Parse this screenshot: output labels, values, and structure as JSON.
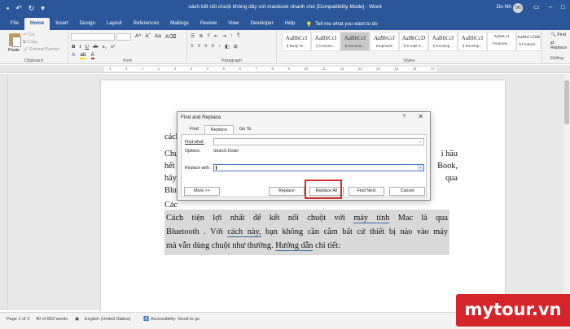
{
  "titlebar": {
    "title": "cách kết nối chuột không dây với macbook nhanh chó [Compatibility Mode] - Word",
    "user": "Do Nh",
    "avatar": "DN"
  },
  "tabs": [
    "File",
    "Home",
    "Insert",
    "Design",
    "Layout",
    "References",
    "Mailings",
    "Review",
    "View",
    "Developer",
    "Help"
  ],
  "tell_me": "Tell me what you want to do",
  "clipboard": {
    "paste": "Paste",
    "cut": "Cut",
    "copy": "Copy",
    "format_painter": "Format Painter",
    "label": "Clipboard"
  },
  "font": {
    "label": "Font"
  },
  "paragraph": {
    "label": "Paragraph"
  },
  "styles": {
    "label": "Styles",
    "items": [
      {
        "sample": "AaBbCcI",
        "name": "¶ Body Te..."
      },
      {
        "sample": "AaBbCcI",
        "name": "¶ Comme..."
      },
      {
        "sample": "AaBbCcI",
        "name": "¶ Docume..."
      },
      {
        "sample": "AaBbCcI",
        "name": "Emphasis"
      },
      {
        "sample": "AaBbCcD",
        "name": "¶ E-mail S..."
      },
      {
        "sample": "AaBbCcI",
        "name": "¶ Envelop..."
      },
      {
        "sample": "AaBbCcI",
        "name": "¶ Envelop..."
      },
      {
        "sample": "AaBbCcI",
        "name": "Footnote..."
      },
      {
        "sample": "AaBbCcDdE",
        "name": "¶ Footnot..."
      }
    ]
  },
  "editing": {
    "find": "Find",
    "replace": "Replace",
    "label": "Editing"
  },
  "ruler_numbers": [
    "3",
    "2",
    "1",
    "1",
    "2",
    "3",
    "4",
    "5",
    "6",
    "7",
    "8",
    "9",
    "10",
    "11",
    "12",
    "13",
    "14",
    "15",
    "16",
    "17"
  ],
  "document": {
    "left_fragments": [
      "cách",
      "Chu",
      "hết",
      "hãy",
      "Blu",
      "Các"
    ],
    "right_fragments": [
      "i hầu",
      "Book,",
      "qua"
    ],
    "highlight_lines": [
      [
        "Cách",
        "tiện",
        "lợi",
        "nhất",
        "để",
        "kết",
        "nối",
        "chuột",
        "với",
        "máy tính",
        "Mac",
        "là",
        "qua"
      ],
      [
        "Bluetooth .",
        "Với",
        "cách này,",
        "bạn",
        "không",
        "cần",
        "cắm",
        "bất cứ",
        "thiết",
        "bị",
        "nào",
        "vào",
        "máy"
      ],
      [
        "mà",
        "vẫn",
        "dùng",
        "chuột",
        "như",
        "thường.",
        "Hướng dẫn",
        "chi",
        "tiết:"
      ]
    ]
  },
  "dialog": {
    "title": "Find and Replace",
    "help": "?",
    "close": "✕",
    "tabs": [
      "Find",
      "Replace",
      "Go To"
    ],
    "find_label": "Find what:",
    "options_label": "Options:",
    "options_value": "Search Down",
    "replace_label": "Replace with:",
    "find_value": "",
    "replace_value": "",
    "buttons": {
      "more": "More >>",
      "replace": "Replace",
      "replace_all": "Replace All",
      "find_next": "Find Next",
      "cancel": "Cancel"
    }
  },
  "status": {
    "page": "Page 1 of 3",
    "words": "40 of 803 words",
    "language": "English (United States)",
    "accessibility": "Accessibility: Good to go"
  },
  "watermark": "mytour.vn",
  "colors": {
    "accent": "#2b579a",
    "highlight_box": "#d42d2d",
    "watermark": "#d6242b"
  }
}
